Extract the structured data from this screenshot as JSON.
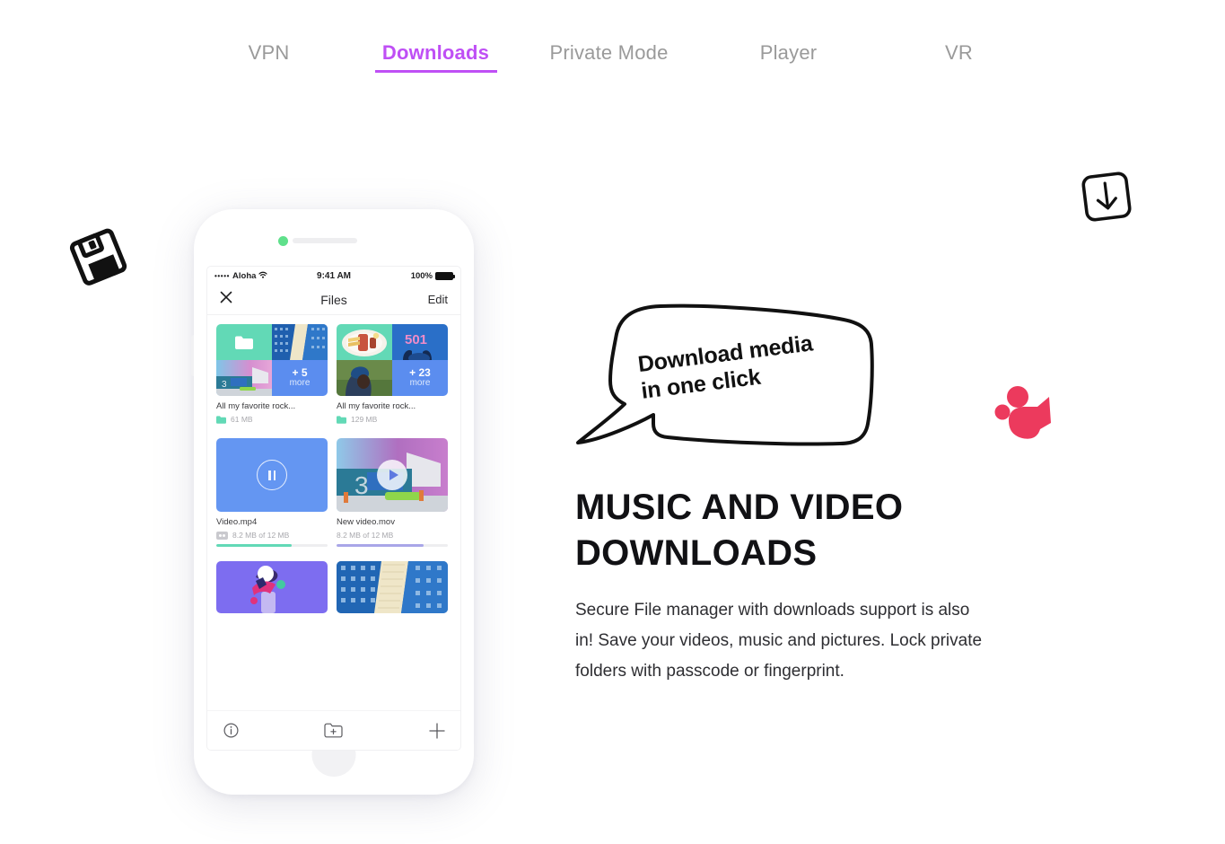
{
  "nav": {
    "items": [
      {
        "label": "VPN",
        "active": false
      },
      {
        "label": "Downloads",
        "active": true
      },
      {
        "label": "Private Mode",
        "active": false
      },
      {
        "label": "Player",
        "active": false
      },
      {
        "label": "VR",
        "active": false
      }
    ],
    "accent_color": "#bf4ff5",
    "inactive_color": "#9a9a9a"
  },
  "doodles": {
    "floppy": "floppy-disk-icon",
    "download": "download-arrow-icon",
    "camera": "video-camera-icon",
    "camera_color": "#ec3a5d"
  },
  "bubble": {
    "line1": "Download media",
    "line2": "in one click"
  },
  "hero": {
    "headline": "MUSIC AND VIDEO DOWNLOADS",
    "body": "Secure File manager with downloads support is also in! Save your videos, music and pictures. Lock private folders with passcode or fingerprint."
  },
  "phone": {
    "status_bar": {
      "signal_dots": "•••••",
      "carrier": "Aloha",
      "wifi": "wifi-icon",
      "time": "9:41 AM",
      "battery_percent": "100%"
    },
    "app_bar": {
      "close": "✕",
      "title": "Files",
      "edit": "Edit"
    },
    "folders": [
      {
        "title": "All my favorite rock...",
        "size": "61 MB",
        "more_count": "+ 5",
        "more_label": "more"
      },
      {
        "title": "All my favorite rock...",
        "size": "129 MB",
        "more_count": "+ 23",
        "more_label": "more"
      }
    ],
    "videos": [
      {
        "title": "Video.mp4",
        "size": "8.2 MB of 12 MB",
        "state": "paused",
        "has_vr_badge": true,
        "progress_percent": 68,
        "progress_color": "#62d9b6"
      },
      {
        "title": "New video.mov",
        "size": "8.2 MB of 12 MB",
        "state": "playing",
        "has_vr_badge": false,
        "progress_percent": 78,
        "progress_color": "#a9a6e8"
      }
    ],
    "toolbar": {
      "info": "info-icon",
      "new_folder": "new-folder-icon",
      "add": "plus-icon"
    },
    "colors": {
      "teal": "#62d9b6",
      "blue": "#5b8def",
      "purple": "#7b6ef0"
    }
  }
}
